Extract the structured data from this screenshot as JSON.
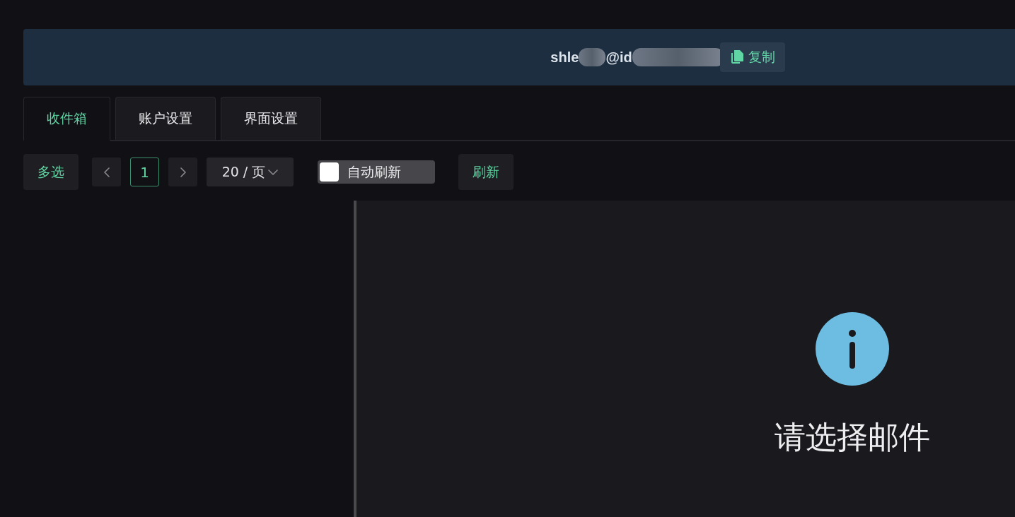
{
  "header": {
    "email_parts": [
      "shle",
      "@id"
    ],
    "copy_button": "复制"
  },
  "tabs": [
    {
      "label": "收件箱",
      "selected": true
    },
    {
      "label": "账户设置",
      "selected": false
    },
    {
      "label": "界面设置",
      "selected": false
    }
  ],
  "toolbar": {
    "multi_select": "多选",
    "pagination": {
      "page": "1"
    },
    "page_size": "20 / 页",
    "auto_refresh": {
      "label": "自动刷新",
      "on": false
    },
    "refresh": "刷新"
  },
  "detail": {
    "empty_message": "请选择邮件"
  }
}
